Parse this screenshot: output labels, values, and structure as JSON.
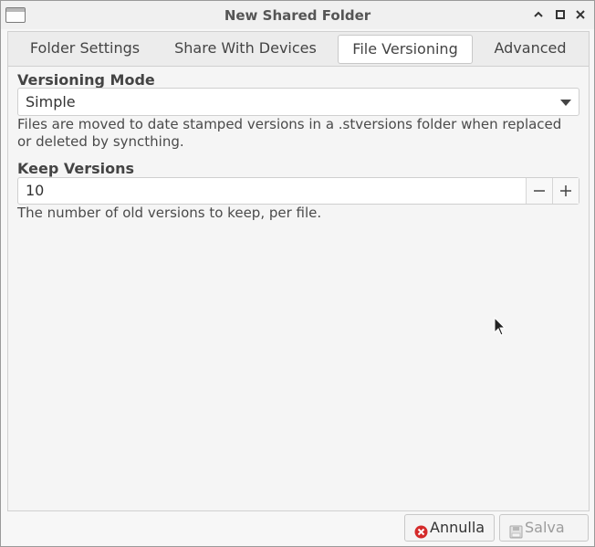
{
  "window": {
    "title": "New Shared Folder"
  },
  "tabs": [
    {
      "label": "Folder Settings"
    },
    {
      "label": "Share With Devices"
    },
    {
      "label": "File Versioning",
      "active": true
    },
    {
      "label": "Advanced"
    }
  ],
  "versioning": {
    "mode_label": "Versioning Mode",
    "mode_value": "Simple",
    "mode_help": "Files are moved to date stamped versions in a .stversions folder when replaced or deleted by syncthing.",
    "keep_label": "Keep Versions",
    "keep_value": "10",
    "keep_help": "The number of old versions to keep, per file."
  },
  "footer": {
    "cancel_label": "Annulla",
    "save_label": "Salva"
  },
  "icons": {
    "cancel": "cancel-icon",
    "save": "save-icon"
  },
  "colors": {
    "cancel_icon": "#d42a2a"
  }
}
